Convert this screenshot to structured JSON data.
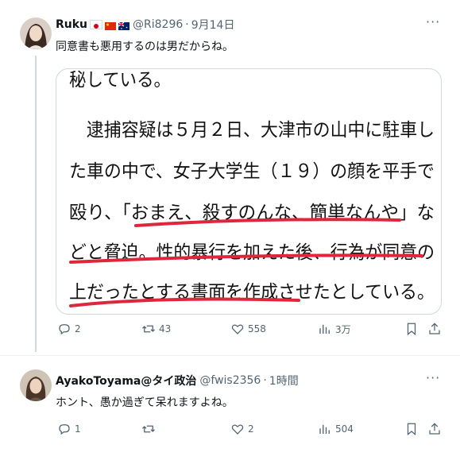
{
  "tweet1": {
    "name": "Ruku",
    "handle": "@Ri8296",
    "separator": "·",
    "time": "9月14日",
    "text": "同意書も悪用するのは男だからね。",
    "more_label": "···",
    "image_text_lines": [
      "秘している。",
      "　逮捕容疑は５月２日、大津市の山中に駐車し",
      "た車の中で、女子大学生（１９）の顔を平手で",
      "殴り、「おまえ、殺すのんな、簡単なんや」な",
      "どと脅迫。性的暴行を加えた後、行為が同意の",
      "上だったとする書面を作成させたとしている。"
    ],
    "actions": {
      "reply_count": "2",
      "retweet_count": "43",
      "like_count": "558",
      "views_count": "3万"
    }
  },
  "tweet2": {
    "name": "AyakoToyama@タイ政治",
    "handle": "@fwis2356",
    "separator": "·",
    "time": "1時間",
    "text": "ホント、愚か過ぎて呆れますよね。",
    "more_label": "···",
    "actions": {
      "reply_count": "1",
      "retweet_count": "",
      "like_count": "2",
      "views_count": "504"
    }
  },
  "colors": {
    "text": "#0f1419",
    "secondary": "#536471",
    "underline": "#e0263d",
    "border": "#cfd9de"
  },
  "icons": [
    "reply-icon",
    "retweet-icon",
    "like-icon",
    "views-icon",
    "bookmark-icon",
    "share-icon",
    "more-icon"
  ]
}
